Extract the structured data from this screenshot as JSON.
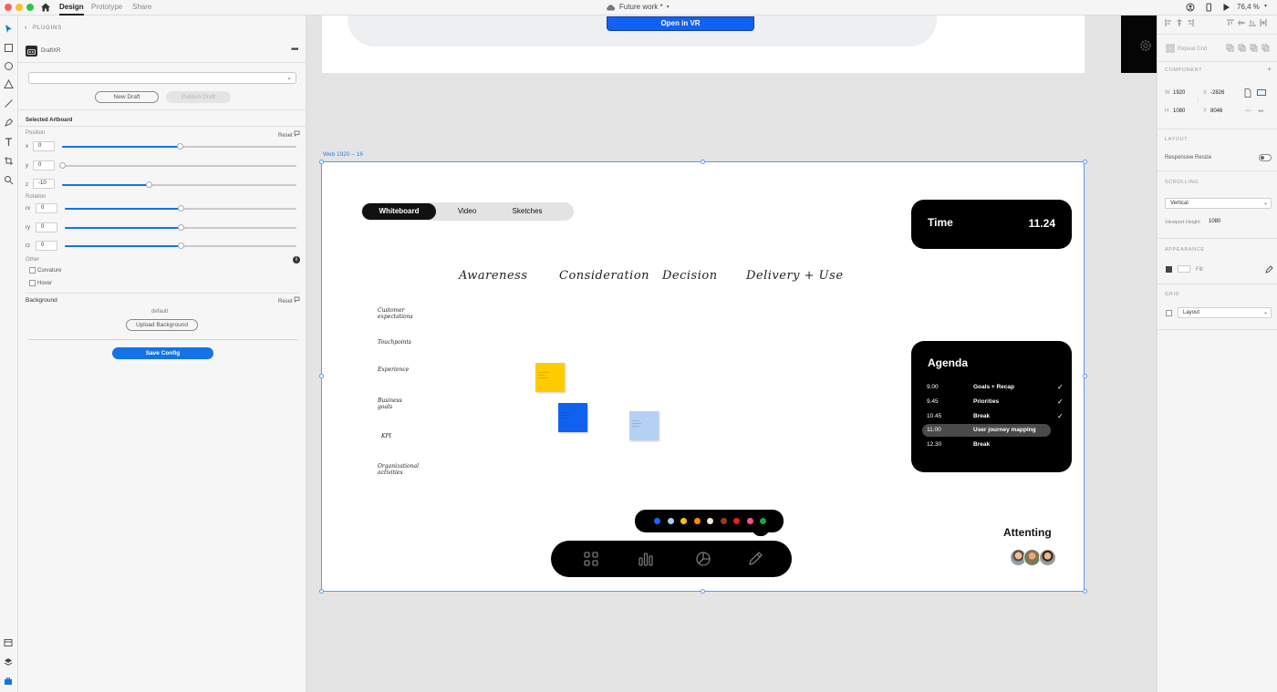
{
  "titlebar": {
    "tabs": [
      "Design",
      "Prototype",
      "Share"
    ],
    "document_title": "Future work *",
    "zoom": "76,4 %"
  },
  "plugin_panel": {
    "header": "PLUGINS",
    "plugin_name": "DraftXR",
    "new_draft": "New Draft",
    "publish_draft": "Publish Draft",
    "selected_artboard": "Selected Artboard",
    "reset": "Reset",
    "position_label": "Position",
    "position": [
      {
        "axis": "x",
        "value": "0",
        "level": 0.5
      },
      {
        "axis": "y",
        "value": "0",
        "level": 0.0
      },
      {
        "axis": "z",
        "value": "-10",
        "level": 0.37
      }
    ],
    "rotation_label": "Rotation",
    "rotation": [
      {
        "axis": "rx",
        "value": "0",
        "level": 0.5
      },
      {
        "axis": "ry",
        "value": "0",
        "level": 0.5
      },
      {
        "axis": "rz",
        "value": "0",
        "level": 0.5
      }
    ],
    "other_label": "Other",
    "curvature": "Curvature",
    "hover": "Hover",
    "background_label": "Background",
    "background_value": "default",
    "upload_background": "Upload Background",
    "save_config": "Save Config"
  },
  "properties_panel": {
    "repeat_grid": "Repeat Grid",
    "component": "COMPONENT",
    "w_label": "W",
    "w": "1920",
    "x_label": "X",
    "x": "-2826",
    "h_label": "H",
    "h": "1080",
    "y_label": "Y",
    "y": "8046",
    "layout": "LAYOUT",
    "responsive_resize": "Responsive Resize",
    "scrolling": "SCROLLING",
    "scroll_mode": "Vertical",
    "viewport_height_label": "Viewport Height",
    "viewport_height": "1080",
    "appearance": "APPEARANCE",
    "fill_label": "Fill",
    "grid": "GRID",
    "grid_mode": "Layout"
  },
  "canvas": {
    "open_vr": "Open in VR",
    "artboard_label": "Web 1920 – 16",
    "tabs": [
      "Whiteboard",
      "Video",
      "Sketches"
    ],
    "time_label": "Time",
    "time_value": "11.24",
    "journey_stages": [
      "Awareness",
      "Consideration",
      "Decision",
      "Delivery + Use"
    ],
    "row_labels": [
      "Customer expectations",
      "Touchpoints",
      "Experience",
      "Business goals",
      "KPI",
      "Organizational activities"
    ],
    "agenda_title": "Agenda",
    "agenda": [
      {
        "time": "9.00",
        "item": "Goals + Recap",
        "done": true
      },
      {
        "time": "9.45",
        "item": "Priorities",
        "done": true
      },
      {
        "time": "10.45",
        "item": "Break",
        "done": true
      },
      {
        "time": "11.00",
        "item": "User journey mapping",
        "done": false,
        "current": true
      },
      {
        "time": "12.30",
        "item": "Break",
        "done": false
      }
    ],
    "palette_colors": [
      "#1666ff",
      "#a9cdf5",
      "#ffc400",
      "#ff8a00",
      "#f3e6d3",
      "#8b4513",
      "#e0241b",
      "#ff4f8b",
      "#18a33f"
    ],
    "attending": "Attenting",
    "sticky_colors": [
      "#ffcc00",
      "#1061f0",
      "#b4d0f5"
    ]
  }
}
